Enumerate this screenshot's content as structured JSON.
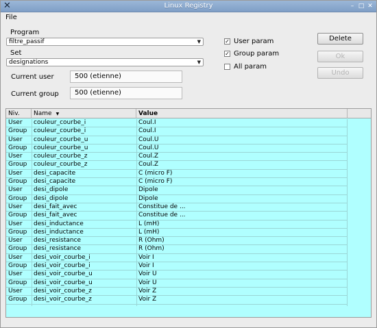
{
  "window": {
    "title": "Linux Registry"
  },
  "menu": {
    "file": "File"
  },
  "program": {
    "label": "Program",
    "value": "filtre_passif"
  },
  "set": {
    "label": "Set",
    "value": "designations"
  },
  "current_user": {
    "label": "Current user",
    "value": "500 (etienne)"
  },
  "current_group": {
    "label": "Current group",
    "value": "500 (etienne)"
  },
  "options": {
    "user_param": {
      "label": "User param",
      "checked": true
    },
    "group_param": {
      "label": "Group param",
      "checked": true
    },
    "all_param": {
      "label": "All param",
      "checked": false
    }
  },
  "buttons": {
    "delete": "Delete",
    "ok": "Ok",
    "undo": "Undo"
  },
  "table": {
    "headers": [
      "Niv.",
      "Name",
      "Value"
    ],
    "rows": [
      [
        "User",
        "couleur_courbe_i",
        "Coul.I"
      ],
      [
        "Group",
        "couleur_courbe_i",
        "Coul.I"
      ],
      [
        "User",
        "couleur_courbe_u",
        "Coul.U"
      ],
      [
        "Group",
        "couleur_courbe_u",
        "Coul.U"
      ],
      [
        "User",
        "couleur_courbe_z",
        "Coul.Z"
      ],
      [
        "Group",
        "couleur_courbe_z",
        "Coul.Z"
      ],
      [
        "User",
        "desi_capacite",
        "C (micro F)"
      ],
      [
        "Group",
        "desi_capacite",
        "C (micro F)"
      ],
      [
        "User",
        "desi_dipole",
        "Dipole"
      ],
      [
        "Group",
        "desi_dipole",
        "Dipole"
      ],
      [
        "User",
        "desi_fait_avec",
        "Constitue de ..."
      ],
      [
        "Group",
        "desi_fait_avec",
        "Constitue de ..."
      ],
      [
        "User",
        "desi_inductance",
        "L (mH)"
      ],
      [
        "Group",
        "desi_inductance",
        "L (mH)"
      ],
      [
        "User",
        "desi_resistance",
        "R (Ohm)"
      ],
      [
        "Group",
        "desi_resistance",
        "R (Ohm)"
      ],
      [
        "User",
        "desi_voir_courbe_i",
        "Voir I"
      ],
      [
        "Group",
        "desi_voir_courbe_i",
        "Voir I"
      ],
      [
        "User",
        "desi_voir_courbe_u",
        "Voir U"
      ],
      [
        "Group",
        "desi_voir_courbe_u",
        "Voir U"
      ],
      [
        "User",
        "desi_voir_courbe_z",
        "Voir Z"
      ],
      [
        "Group",
        "desi_voir_courbe_z",
        "Voir Z"
      ]
    ]
  },
  "colors": {
    "table_bg": "#b0ffff",
    "titlebar": "#8eabd0"
  }
}
